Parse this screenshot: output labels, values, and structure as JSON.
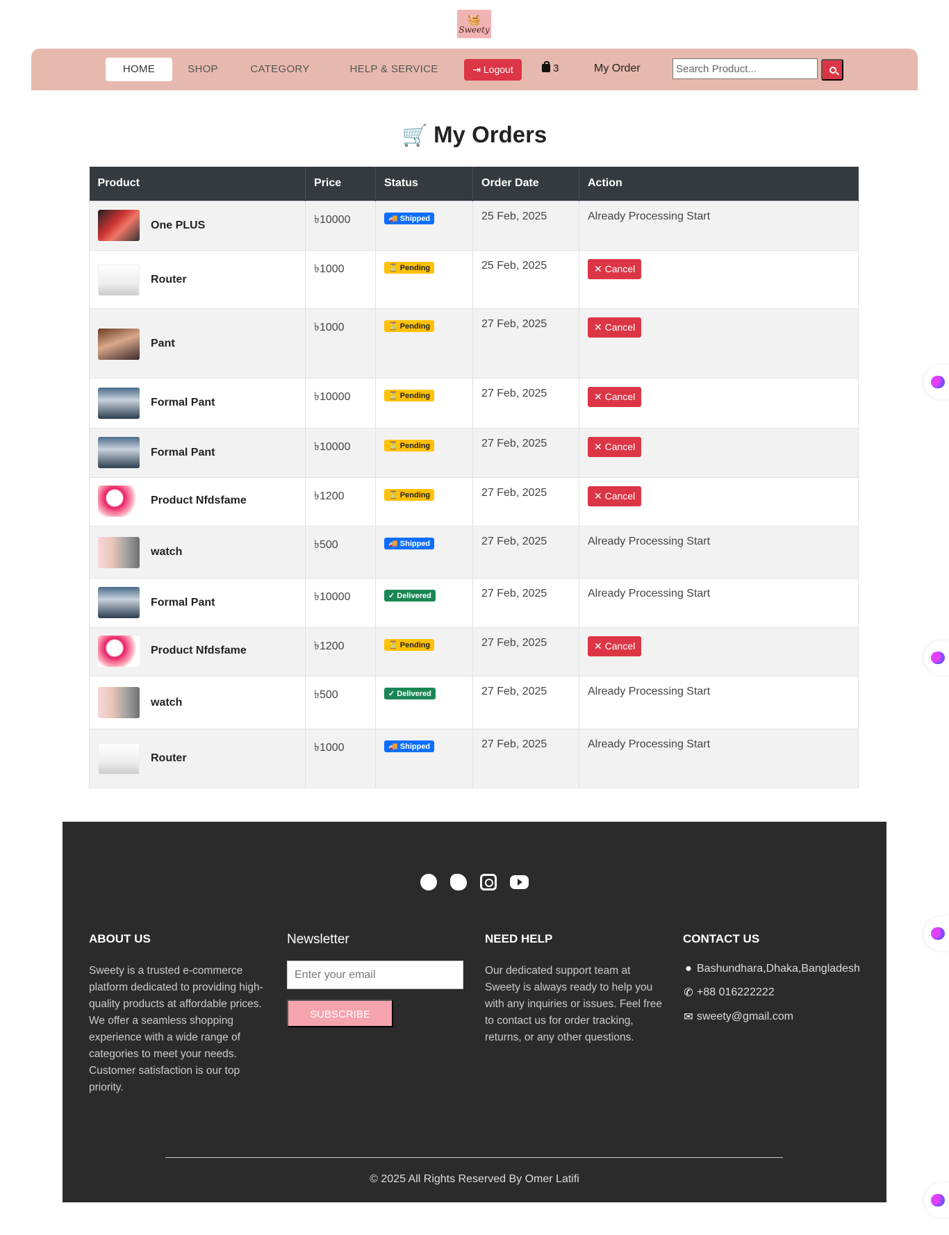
{
  "brand": {
    "logo_text": "Sweety"
  },
  "nav": {
    "home": "HOME",
    "shop": "SHOP",
    "category": "CATEGORY",
    "help": "HELP & SERVICE",
    "logout": "Logout",
    "cart_count": "3",
    "my_order": "My Order",
    "search_placeholder": "Search Product..."
  },
  "page": {
    "title": "My Orders"
  },
  "table": {
    "headers": [
      "Product",
      "Price",
      "Status",
      "Order Date",
      "Action"
    ],
    "rows": [
      {
        "name": "One PLUS",
        "price": "৳10000",
        "status": "Shipped",
        "date": "25 Feb, 2025",
        "action": "Already Processing Start"
      },
      {
        "name": "Router",
        "price": "৳1000",
        "status": "Pending",
        "date": "25 Feb, 2025",
        "action": "Cancel"
      },
      {
        "name": "Pant",
        "price": "৳1000",
        "status": "Pending",
        "date": "27 Feb, 2025",
        "action": "Cancel"
      },
      {
        "name": "Formal Pant",
        "price": "৳10000",
        "status": "Pending",
        "date": "27 Feb, 2025",
        "action": "Cancel"
      },
      {
        "name": "Formal Pant",
        "price": "৳10000",
        "status": "Pending",
        "date": "27 Feb, 2025",
        "action": "Cancel"
      },
      {
        "name": "Product Nfdsfame",
        "price": "৳1200",
        "status": "Pending",
        "date": "27 Feb, 2025",
        "action": "Cancel"
      },
      {
        "name": "watch",
        "price": "৳500",
        "status": "Shipped",
        "date": "27 Feb, 2025",
        "action": "Already Processing Start"
      },
      {
        "name": "Formal Pant",
        "price": "৳10000",
        "status": "Delivered",
        "date": "27 Feb, 2025",
        "action": "Already Processing Start"
      },
      {
        "name": "Product Nfdsfame",
        "price": "৳1200",
        "status": "Pending",
        "date": "27 Feb, 2025",
        "action": "Cancel"
      },
      {
        "name": "watch",
        "price": "৳500",
        "status": "Delivered",
        "date": "27 Feb, 2025",
        "action": "Already Processing Start"
      },
      {
        "name": "Router",
        "price": "৳1000",
        "status": "Shipped",
        "date": "27 Feb, 2025",
        "action": "Already Processing Start"
      }
    ]
  },
  "footer": {
    "socials": [
      "facebook-icon",
      "twitter-icon",
      "instagram-icon",
      "youtube-icon"
    ],
    "about_title": "ABOUT US",
    "about_text": "Sweety is a trusted e-commerce platform dedicated to providing high-quality products at affordable prices. We offer a seamless shopping experience with a wide range of categories to meet your needs. Customer satisfaction is our top priority.",
    "newsletter_title": "Newsletter",
    "newsletter_placeholder": "Enter your email",
    "subscribe": "SUBSCRIBE",
    "help_title": "NEED HELP",
    "help_text": "Our dedicated support team at Sweety is always ready to help you with any inquiries or issues. Feel free to contact us for order tracking, returns, or any other questions.",
    "contact_title": "CONTACT US",
    "address": "Bashundhara,Dhaka,Bangladesh",
    "phone": "+88 016222222",
    "email": "sweety@gmail.com",
    "copyright": "© 2025 All Rights Reserved By Omer Latifi"
  },
  "colors": {
    "navbar": "#e7b9ae",
    "danger": "#dc3545",
    "table_header": "#343a40",
    "footer": "#2b2b2b",
    "shipped": "#0d6efd",
    "pending": "#ffc107",
    "delivered": "#198754"
  }
}
